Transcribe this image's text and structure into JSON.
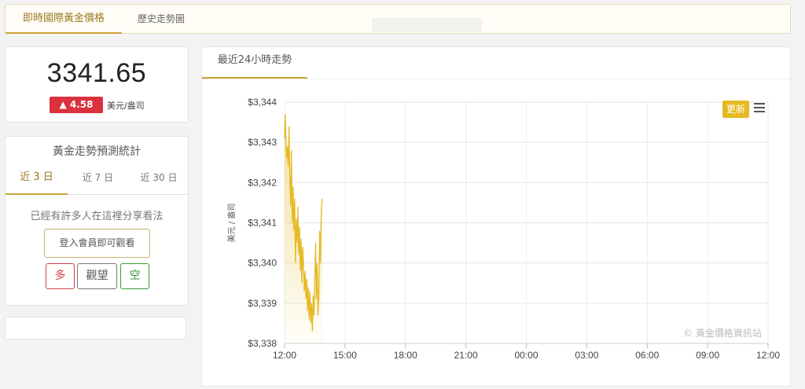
{
  "nav": {
    "tabs": [
      {
        "label": "即時國際黃金價格",
        "active": true
      },
      {
        "label": "歷史走勢圖",
        "active": false
      }
    ]
  },
  "price": {
    "value": "3341.65",
    "change": "▲ 4.58",
    "unit": "美元/盎司",
    "change_color": "#d9323d"
  },
  "forecast": {
    "title": "黃金走勢預測統計",
    "periods": [
      "近 3 日",
      "近 7 日",
      "近 30 日"
    ],
    "active_period": "近 3 日",
    "share_text": "已經有許多人在這裡分享看法",
    "login_label": "登入會員即可觀看",
    "votes": {
      "long": "多",
      "wait": "觀望",
      "short": "空"
    }
  },
  "chart_panel": {
    "tab_label": "最近24小時走勢",
    "refresh_label": "更新",
    "menu_icon": "hamburger-menu-icon",
    "watermark": "© 黃金價格資訊站"
  },
  "chart_data": {
    "type": "area",
    "ylabel": "美元 / 盎司",
    "ylim": [
      3338,
      3344
    ],
    "y_ticks": [
      "$3,344",
      "$3,343",
      "$3,342",
      "$3,341",
      "$3,340",
      "$3,339",
      "$3,338"
    ],
    "x_ticks": [
      "12:00",
      "15:00",
      "18:00",
      "21:00",
      "00:00",
      "03:00",
      "06:00",
      "09:00",
      "12:00"
    ],
    "xlim_hours": [
      0,
      24
    ],
    "grid": true,
    "line_color": "#e5b922",
    "series": [
      {
        "x": [
          0.0,
          0.03,
          0.06,
          0.1,
          0.14,
          0.18,
          0.22,
          0.26,
          0.3,
          0.34,
          0.38,
          0.42,
          0.46,
          0.5,
          0.54,
          0.58,
          0.62,
          0.66,
          0.7,
          0.74,
          0.78,
          0.82,
          0.86,
          0.9,
          0.94,
          0.98,
          1.02,
          1.06,
          1.1,
          1.14,
          1.18,
          1.22,
          1.26,
          1.3,
          1.34,
          1.38,
          1.42,
          1.46,
          1.5,
          1.54,
          1.58,
          1.62,
          1.66,
          1.7,
          1.74,
          1.78,
          1.82,
          1.86
        ],
        "y": [
          3343.1,
          3343.7,
          3343.2,
          3342.6,
          3342.9,
          3342.4,
          3343.4,
          3342.2,
          3341.4,
          3342.8,
          3341.0,
          3341.9,
          3340.8,
          3341.6,
          3340.0,
          3341.1,
          3340.5,
          3341.4,
          3340.2,
          3340.9,
          3339.8,
          3340.6,
          3339.5,
          3340.4,
          3339.9,
          3339.3,
          3339.8,
          3339.1,
          3339.6,
          3338.8,
          3339.4,
          3338.6,
          3339.3,
          3338.5,
          3339.0,
          3338.3,
          3339.2,
          3338.7,
          3339.6,
          3340.5,
          3339.1,
          3340.0,
          3338.7,
          3339.2,
          3340.8,
          3340.0,
          3341.2,
          3341.6
        ]
      }
    ]
  }
}
